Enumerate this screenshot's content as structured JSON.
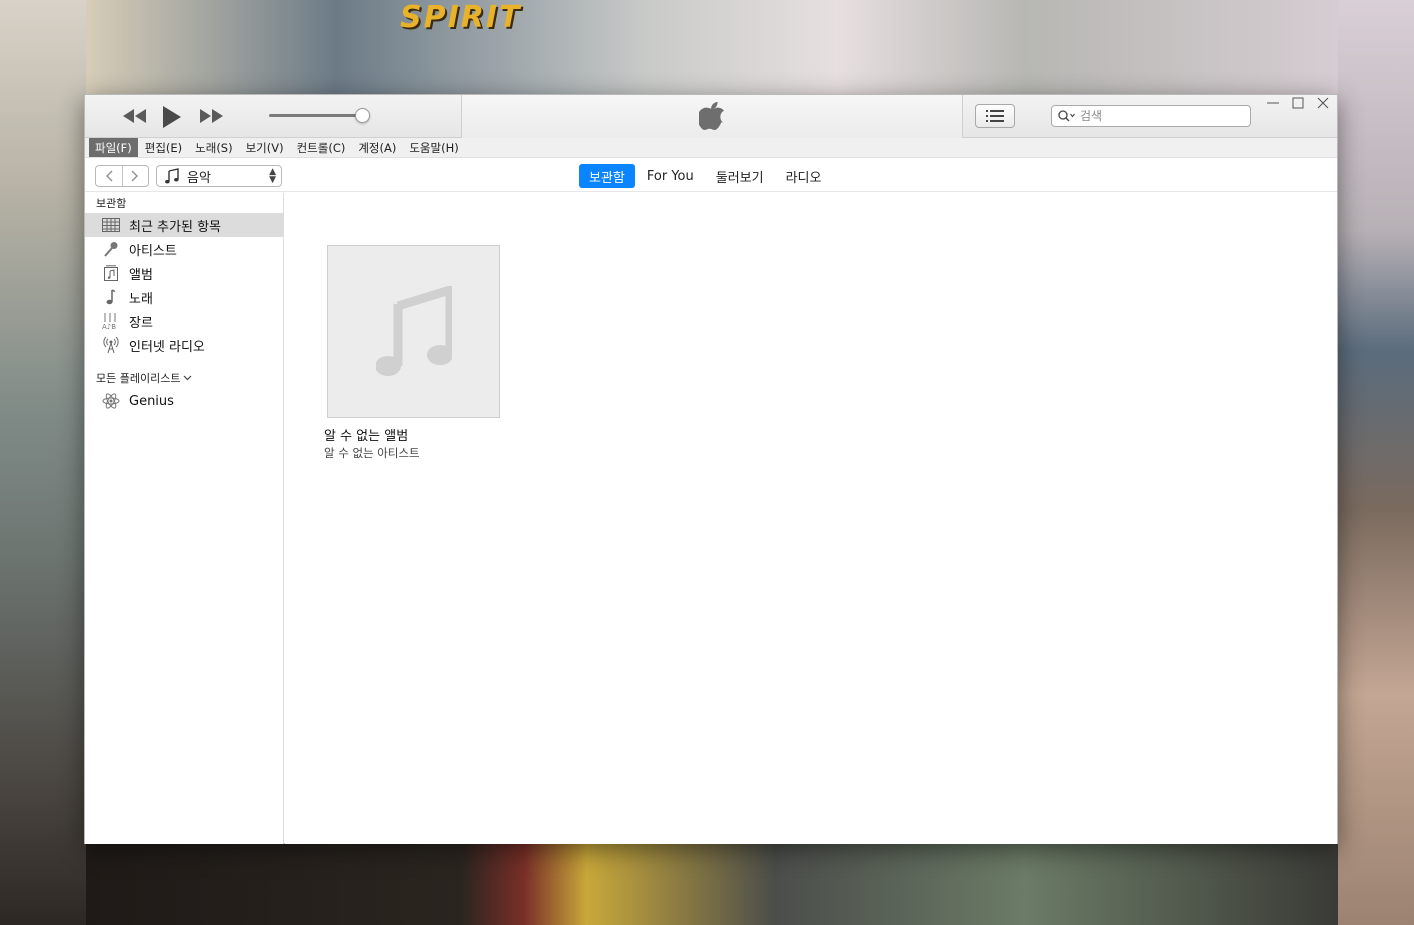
{
  "window": {
    "title_icon": "apple-logo-icon"
  },
  "player": {
    "rewind_icon": "rewind-icon",
    "play_icon": "play-icon",
    "forward_icon": "fast-forward-icon",
    "volume_level": 0.9
  },
  "search": {
    "placeholder": "검색"
  },
  "menu": [
    {
      "label": "파일(F)",
      "active": true
    },
    {
      "label": "편집(E)"
    },
    {
      "label": "노래(S)"
    },
    {
      "label": "보기(V)"
    },
    {
      "label": "컨트롤(C)"
    },
    {
      "label": "계정(A)"
    },
    {
      "label": "도움말(H)"
    }
  ],
  "media_selector": {
    "value": "음악"
  },
  "tabs": [
    {
      "label": "보관함",
      "active": true
    },
    {
      "label": "For You"
    },
    {
      "label": "둘러보기"
    },
    {
      "label": "라디오"
    }
  ],
  "sidebar": {
    "library_header": "보관함",
    "items": [
      {
        "label": "최근 추가된 항목",
        "icon": "grid-icon",
        "active": true
      },
      {
        "label": "아티스트",
        "icon": "microphone-icon"
      },
      {
        "label": "앨범",
        "icon": "album-icon"
      },
      {
        "label": "노래",
        "icon": "music-note-icon"
      },
      {
        "label": "장르",
        "icon": "genre-icon"
      },
      {
        "label": "인터넷 라디오",
        "icon": "antenna-icon"
      }
    ],
    "playlists_header": "모든 플레이리스트",
    "playlists": [
      {
        "label": "Genius",
        "icon": "genius-atom-icon"
      }
    ]
  },
  "content": {
    "albums": [
      {
        "title": "알 수 없는 앨범",
        "artist": "알 수 없는 아티스트"
      }
    ]
  },
  "colors": {
    "accent": "#0a84ff",
    "menu_active": "#6d6d6d"
  }
}
